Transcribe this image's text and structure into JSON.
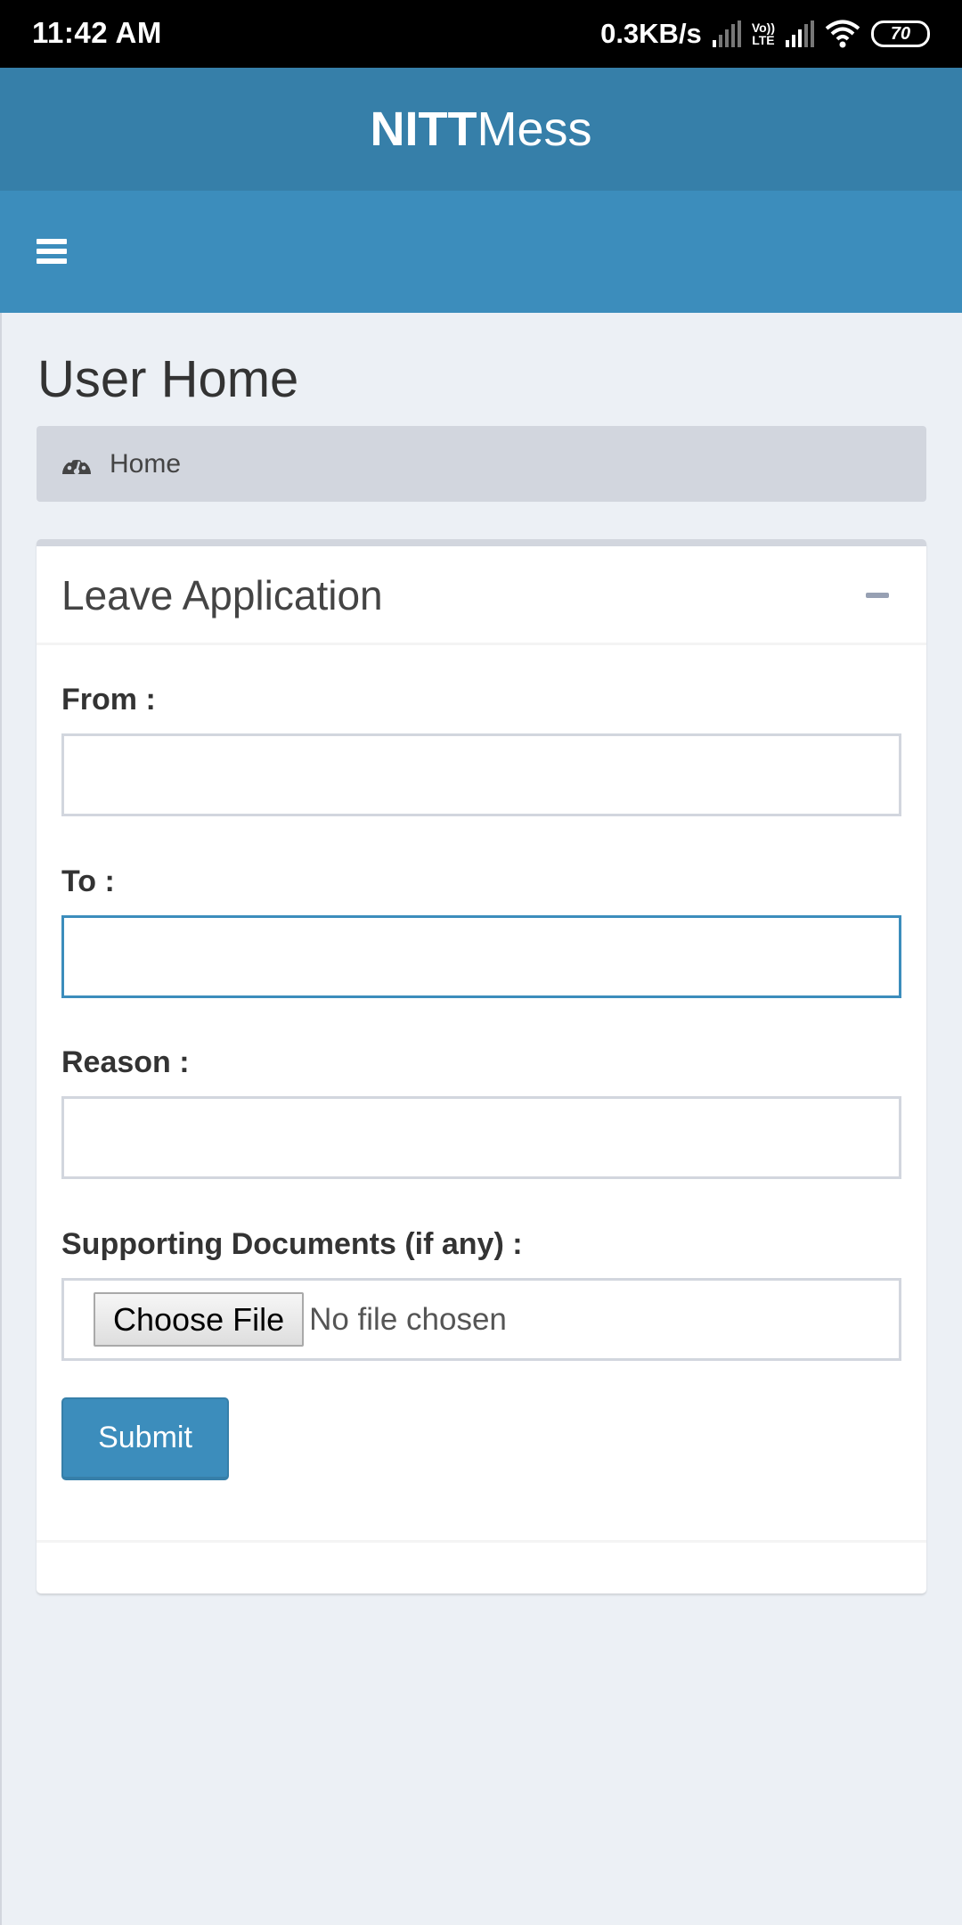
{
  "status_bar": {
    "time": "11:42 AM",
    "net_speed": "0.3KB/s",
    "volte_top": "Vo))",
    "volte_bottom": "LTE",
    "battery": "70",
    "icons": [
      "signal-icon",
      "volte-icon",
      "signal-icon",
      "wifi-icon",
      "battery-icon"
    ]
  },
  "header": {
    "logo_bold": "NITT",
    "logo_light": "Mess"
  },
  "navbar": {
    "menu_icon": "hamburger-menu-icon"
  },
  "page": {
    "title": "User Home",
    "breadcrumb": {
      "icon": "dashboard-gauge-icon",
      "label": "Home"
    }
  },
  "leave_form": {
    "title": "Leave Application",
    "collapse_icon": "minus-icon",
    "fields": [
      {
        "label": "From :",
        "value": "",
        "focused": false
      },
      {
        "label": "To :",
        "value": "",
        "focused": true
      },
      {
        "label": "Reason :",
        "value": ""
      }
    ],
    "documents": {
      "label": "Supporting Documents (if any) :",
      "button_label": "Choose File",
      "status": "No file chosen"
    },
    "submit_label": "Submit"
  },
  "colors": {
    "header": "#367fa9",
    "navbar": "#3c8dbc",
    "background": "#ecf0f5",
    "breadcrumb": "#d2d6de",
    "focus_border": "#3c8dbc"
  }
}
